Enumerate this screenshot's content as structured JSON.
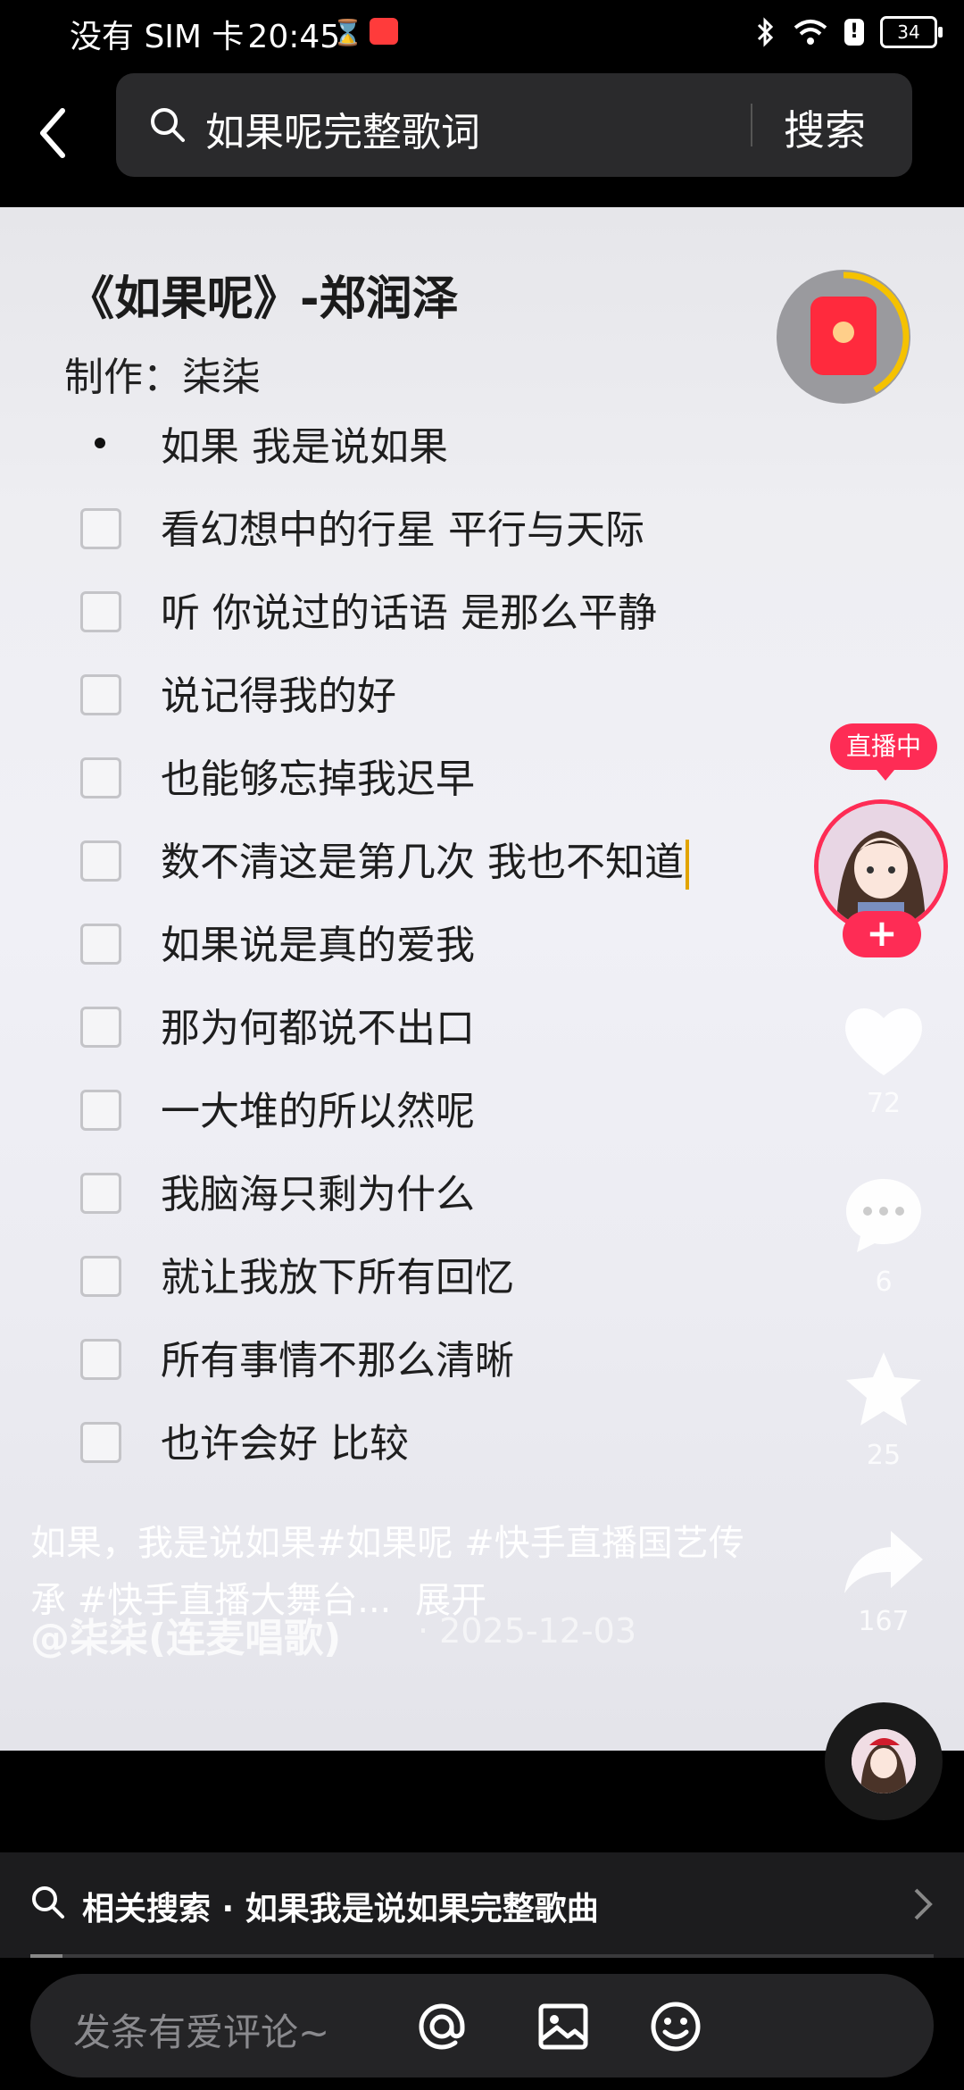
{
  "status_bar": {
    "carrier": "没有 SIM 卡",
    "time": "20:45",
    "battery": "34"
  },
  "search": {
    "query": "如果呢完整歌词",
    "button_label": "搜索"
  },
  "video": {
    "lyrics_title": "《如果呢》-郑润泽",
    "author_line": "制作：柒柒",
    "first_line": "如果 我是说如果",
    "lyric_lines": [
      "看幻想中的行星 平行与天际",
      "听 你说过的话语 是那么平静",
      "说记得我的好",
      "也能够忘掉我迟早",
      "数不清这是第几次 我也不知道",
      "如果说是真的爱我",
      "那为何都说不出口",
      "一大堆的所以然呢",
      "我脑海只剩为什么",
      "就让我放下所有回忆",
      "所有事情不那么清晰",
      "也许会好 比较"
    ]
  },
  "side_actions": {
    "live_label": "直播中",
    "likes": "72",
    "comments": "6",
    "favorites": "25",
    "shares": "167"
  },
  "caption": {
    "username": "@柒柒(连麦唱歌)",
    "date": "· 2025-12-03",
    "text": "如果，我是说如果#如果呢 #快手直播国艺传承 #快手直播大舞台...",
    "expand": "展开"
  },
  "related_search": {
    "label": "相关搜索 · 如果我是说如果完整歌曲"
  },
  "comment_bar": {
    "placeholder": "发条有爱评论~"
  },
  "colors": {
    "accent": "#fe2c55",
    "caret": "#e2a400"
  }
}
